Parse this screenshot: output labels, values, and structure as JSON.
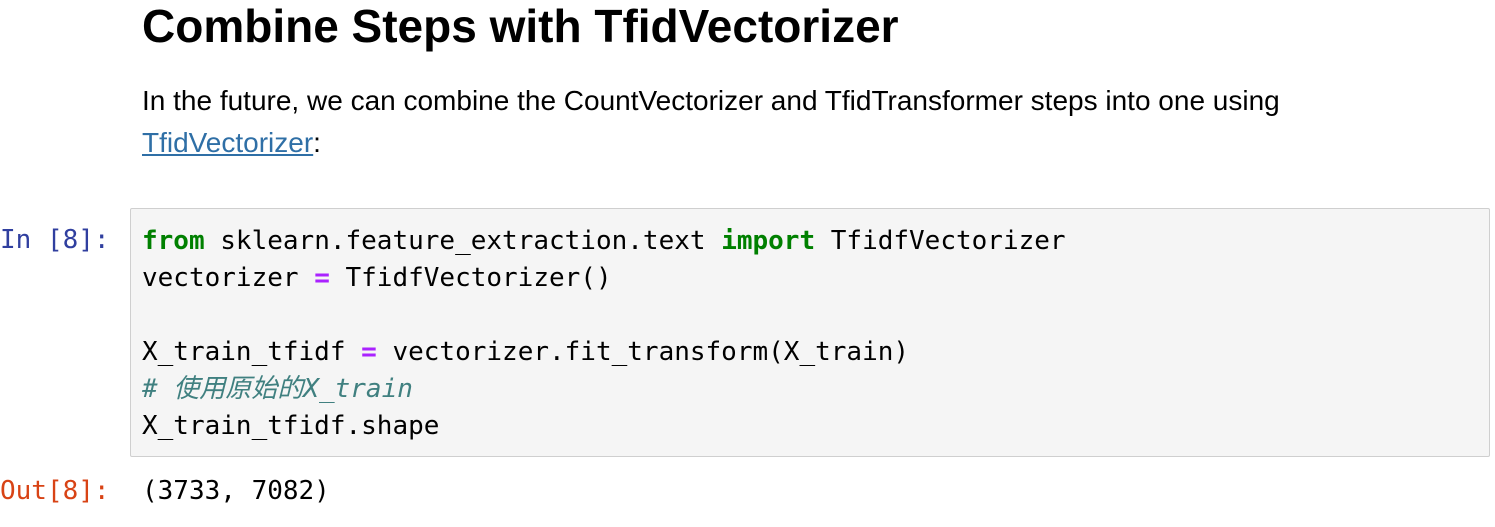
{
  "markdown": {
    "title": "Combine Steps with TfidVectorizer",
    "paragraph_text": "In the future, we can combine the CountVectorizer and TfidTransformer steps into one using ",
    "link_text": "TfidVectorizer",
    "paragraph_suffix": ":"
  },
  "code_cell": {
    "input_prompt": "In [8]:",
    "output_prompt": "Out[8]:",
    "line1": {
      "kw_from": "from",
      "module": " sklearn.feature_extraction.text ",
      "kw_import": "import",
      "name": " TfidfVectorizer"
    },
    "line2": {
      "lhs": "vectorizer ",
      "op": "=",
      "rhs": " TfidfVectorizer()"
    },
    "line4": {
      "lhs": "X_train_tfidf ",
      "op": "=",
      "rhs": " vectorizer.fit_transform(X_train)"
    },
    "line5_comment": "# 使用原始的X_train",
    "line6": "X_train_tfidf.shape",
    "output": "(3733, 7082)"
  },
  "colors": {
    "input_prompt": "#303f9f",
    "output_prompt": "#d84315",
    "keyword": "#008000",
    "operator": "#aa22ff",
    "comment": "#408080",
    "link": "#2f6fa6",
    "code_bg": "#f5f5f5"
  }
}
